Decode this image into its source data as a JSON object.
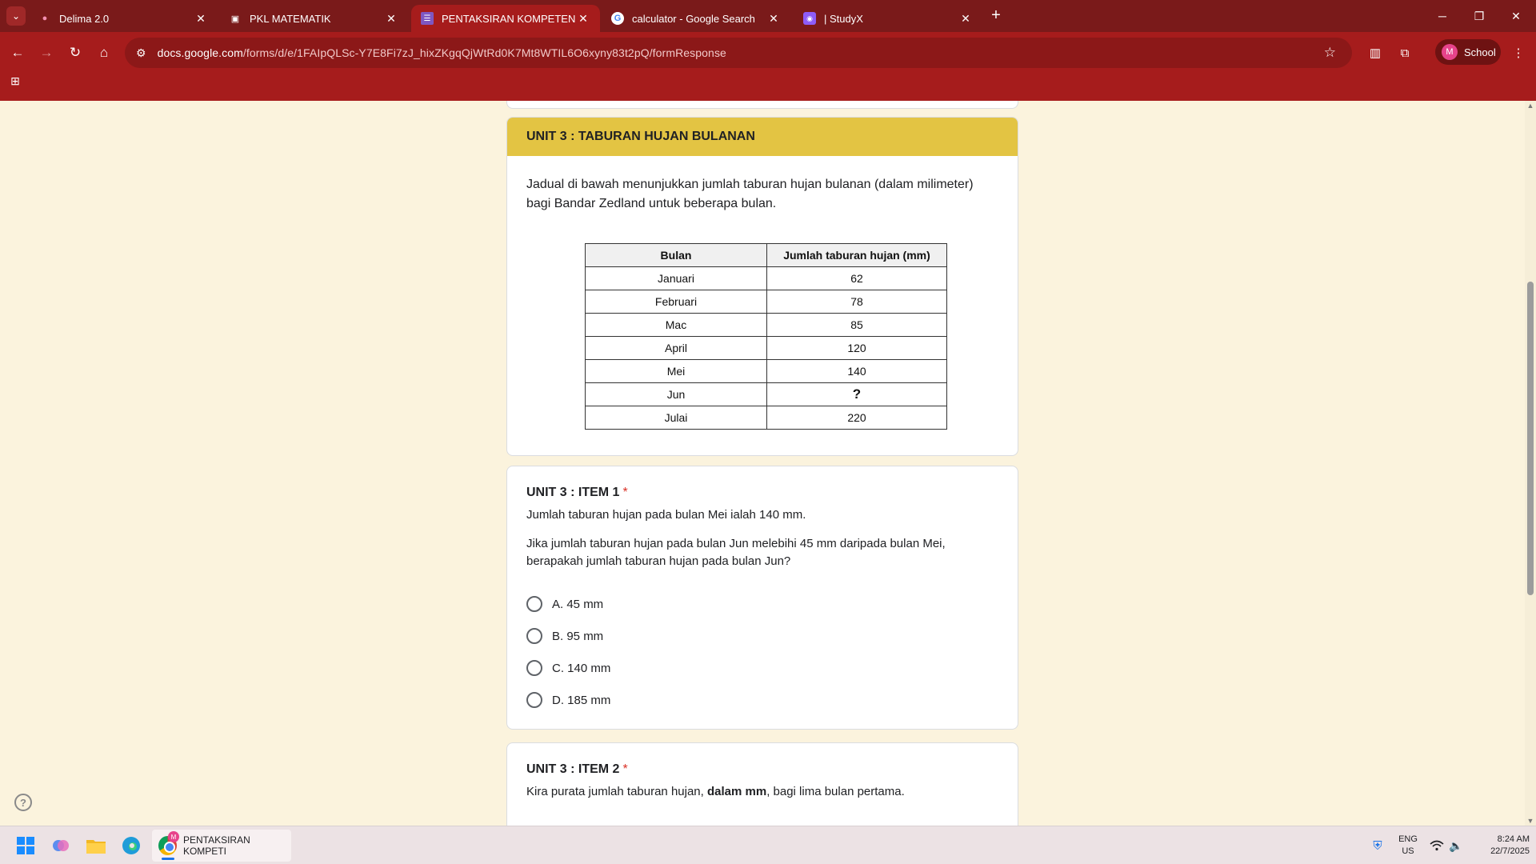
{
  "browser": {
    "tabs": [
      {
        "title": "Delima 2.0",
        "icon": "delima-icon",
        "active": false
      },
      {
        "title": "PKL MATEMATIK",
        "icon": "classroom-icon",
        "active": false
      },
      {
        "title": "PENTAKSIRAN KOMPETENSI DA",
        "icon": "forms-icon",
        "active": true
      },
      {
        "title": "calculator - Google Search",
        "icon": "google-icon",
        "active": false
      },
      {
        "title": "| StudyX",
        "icon": "studyx-icon",
        "active": false
      }
    ],
    "url_host": "docs.google.com",
    "url_path": "/forms/d/e/1FAIpQLSc-Y7E8Fi7zJ_hixZKgqQjWtRd0K7Mt8WTIL6O6xyny83t2pQ/formResponse",
    "profile_initial": "M",
    "profile_label": "School"
  },
  "unit": {
    "header": "UNIT 3 : TABURAN HUJAN BULANAN",
    "description": "Jadual di bawah menunjukkan jumlah taburan hujan bulanan (dalam milimeter) bagi Bandar Zedland untuk beberapa bulan.",
    "table": {
      "headers": [
        "Bulan",
        "Jumlah taburan hujan (mm)"
      ],
      "rows": [
        [
          "Januari",
          "62"
        ],
        [
          "Februari",
          "78"
        ],
        [
          "Mac",
          "85"
        ],
        [
          "April",
          "120"
        ],
        [
          "Mei",
          "140"
        ],
        [
          "Jun",
          "?"
        ],
        [
          "Julai",
          "220"
        ]
      ]
    }
  },
  "item1": {
    "title": "UNIT 3 : ITEM 1",
    "required_mark": "*",
    "text1": "Jumlah taburan hujan pada bulan Mei ialah 140 mm.",
    "text2": "Jika jumlah taburan hujan pada bulan Jun melebihi 45 mm daripada bulan Mei, berapakah jumlah taburan hujan pada bulan Jun?",
    "options": [
      "A. 45 mm",
      "B. 95 mm",
      "C. 140 mm",
      "D. 185 mm"
    ]
  },
  "item2": {
    "title": "UNIT 3 : ITEM 2",
    "required_mark": "*",
    "text_pre": "Kira purata jumlah taburan hujan, ",
    "text_bold": "dalam mm",
    "text_post": ", bagi lima bulan pertama."
  },
  "taskbar": {
    "app_label": "PENTAKSIRAN KOMPETI",
    "app_badge": "M",
    "lang_top": "ENG",
    "lang_bottom": "US",
    "time": "8:24 AM",
    "date": "22/7/2025"
  }
}
